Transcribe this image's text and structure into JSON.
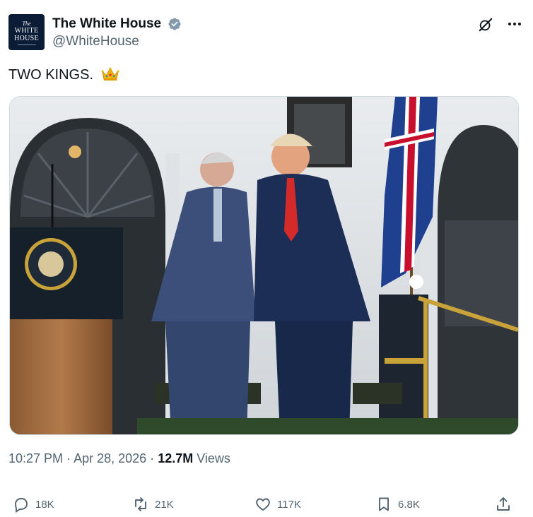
{
  "author": {
    "avatar_text_line1": "The",
    "avatar_text_line2": "WHITE",
    "avatar_text_line3": "HOUSE",
    "display_name": "The White House",
    "handle": "@WhiteHouse",
    "verified_badge_icon": "verified-badge-icon",
    "badge_color": "#829aab"
  },
  "tweet": {
    "text": "TWO KINGS.",
    "emoji_icon": "crown-icon"
  },
  "meta": {
    "time": "10:27 PM",
    "separator": "·",
    "date": "Apr 28, 2026",
    "views_count": "12.7M",
    "views_label": "Views"
  },
  "actions": {
    "replies": "18K",
    "reposts": "21K",
    "likes": "117K",
    "bookmarks": "6.8K"
  },
  "colors": {
    "text_primary": "#0f1419",
    "text_secondary": "#536471",
    "border": "#cfd9de"
  }
}
